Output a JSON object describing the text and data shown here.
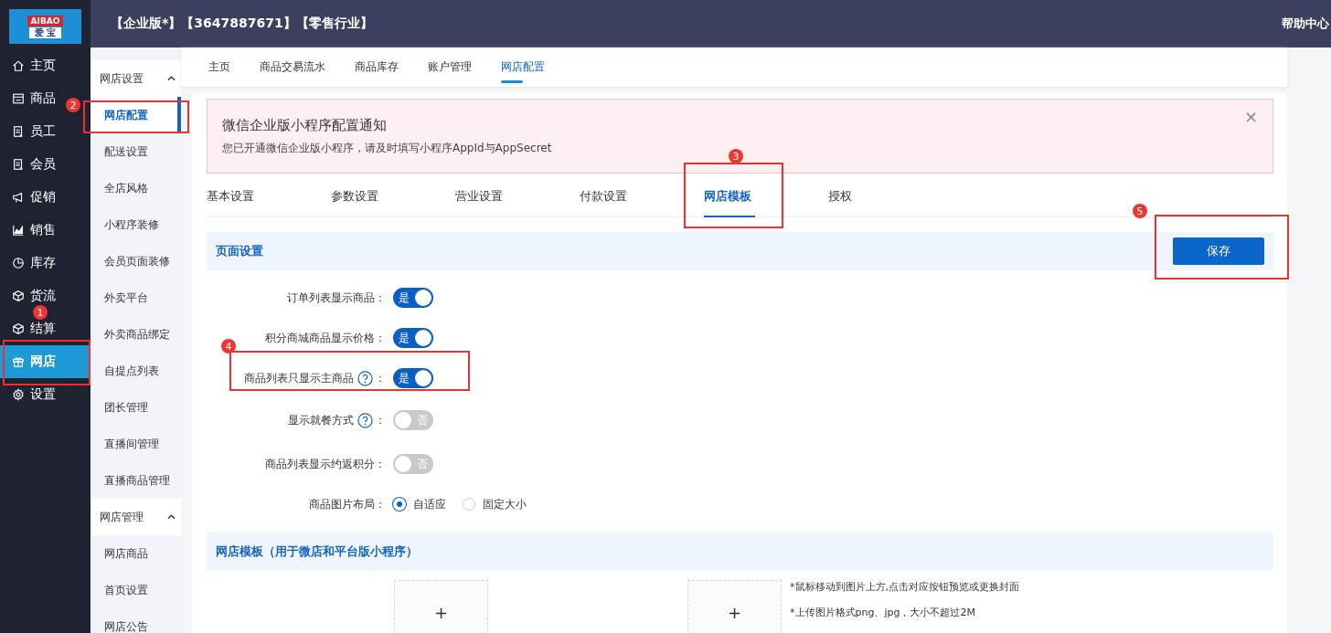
{
  "logo": {
    "top": "AIBAO",
    "bottom": "爱 宝"
  },
  "header": {
    "tags": "【企业版*】【3647887671】【零售行业】",
    "help": "帮助中心"
  },
  "nav": [
    {
      "label": "主页",
      "kind": "home",
      "selected": false
    },
    {
      "label": "商品",
      "kind": "shop",
      "selected": false
    },
    {
      "label": "员工",
      "kind": "doc",
      "selected": false
    },
    {
      "label": "会员",
      "kind": "doc",
      "selected": false
    },
    {
      "label": "促销",
      "kind": "horn",
      "selected": false
    },
    {
      "label": "销售",
      "kind": "chart",
      "selected": false
    },
    {
      "label": "库存",
      "kind": "pie",
      "selected": false
    },
    {
      "label": "货流",
      "kind": "cube",
      "selected": false
    },
    {
      "label": "结算",
      "kind": "cube",
      "selected": false
    },
    {
      "label": "网店",
      "kind": "gift",
      "selected": true
    },
    {
      "label": "设置",
      "kind": "gear",
      "selected": false
    }
  ],
  "subnav": [
    {
      "title": "网店设置",
      "expanded": true,
      "items": [
        {
          "label": "网店配置",
          "selected": true
        },
        {
          "label": "配送设置",
          "selected": false
        },
        {
          "label": "全店风格",
          "selected": false
        },
        {
          "label": "小程序装修",
          "selected": false
        },
        {
          "label": "会员页面装修",
          "selected": false
        },
        {
          "label": "外卖平台",
          "selected": false
        },
        {
          "label": "外卖商品绑定",
          "selected": false
        },
        {
          "label": "自提点列表",
          "selected": false
        },
        {
          "label": "团长管理",
          "selected": false
        },
        {
          "label": "直播间管理",
          "selected": false
        },
        {
          "label": "直播商品管理",
          "selected": false
        }
      ]
    },
    {
      "title": "网店管理",
      "expanded": true,
      "items": [
        {
          "label": "网店商品",
          "selected": false
        },
        {
          "label": "首页设置",
          "selected": false
        },
        {
          "label": "网店公告",
          "selected": false
        }
      ]
    }
  ],
  "page_tabs": [
    {
      "label": "主页",
      "selected": false
    },
    {
      "label": "商品交易流水",
      "selected": false
    },
    {
      "label": "商品库存",
      "selected": false
    },
    {
      "label": "账户管理",
      "selected": false
    },
    {
      "label": "网店配置",
      "selected": true
    }
  ],
  "notice": {
    "title": "微信企业版小程序配置通知",
    "text": "您已开通微信企业版小程序，请及时填写小程序AppId与AppSecret",
    "close": "×"
  },
  "config_tabs": [
    {
      "label": "基本设置",
      "selected": false
    },
    {
      "label": "参数设置",
      "selected": false
    },
    {
      "label": "营业设置",
      "selected": false
    },
    {
      "label": "付款设置",
      "selected": false
    },
    {
      "label": "网店模板",
      "selected": true
    },
    {
      "label": "授权",
      "selected": false
    }
  ],
  "section": {
    "title": "页面设置",
    "save": "保存"
  },
  "settings": [
    {
      "kind": "toggle",
      "label": "订单列表显示商品：",
      "help": false,
      "on": true,
      "text": "是"
    },
    {
      "kind": "toggle",
      "label": "积分商城商品显示价格：",
      "help": false,
      "on": true,
      "text": "是"
    },
    {
      "kind": "toggle",
      "label": "商品列表只显示主商品",
      "help": true,
      "colon": "：",
      "on": true,
      "text": "是"
    },
    {
      "kind": "toggle",
      "label": "显示就餐方式",
      "help": true,
      "colon": "：",
      "on": false,
      "text": "否"
    },
    {
      "kind": "toggle",
      "label": "商品列表显示约返积分：",
      "help": false,
      "on": false,
      "text": "否"
    },
    {
      "kind": "radio",
      "label": "商品图片布局：",
      "options": [
        {
          "label": "自适应",
          "selected": true
        },
        {
          "label": "固定大小",
          "selected": false
        }
      ]
    }
  ],
  "template": {
    "title": "网店模板（用于微店和平台版小程序）",
    "upload_plus": [
      "+",
      "+"
    ],
    "notes": [
      "*鼠标移动到图片上方,点击对应按钮预览或更换封面",
      "*上传图片格式png、jpg，大小不超过2M"
    ]
  },
  "annotations": [
    {
      "number": "1"
    },
    {
      "number": "2"
    },
    {
      "number": "3"
    },
    {
      "number": "4"
    },
    {
      "number": "5"
    }
  ]
}
